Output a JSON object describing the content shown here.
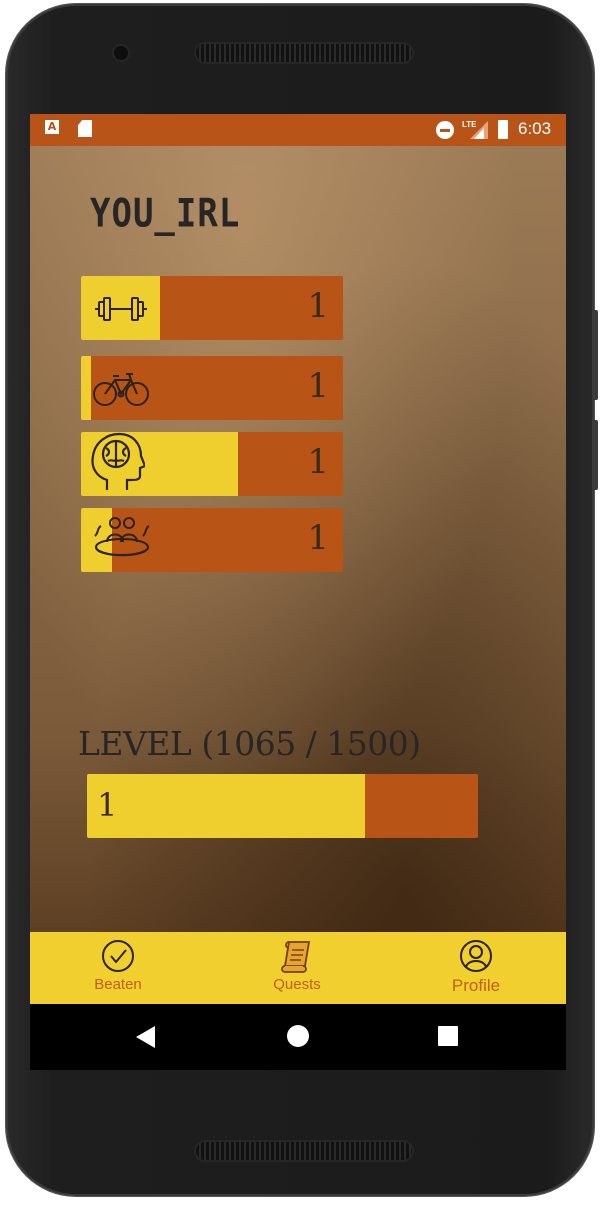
{
  "status_bar": {
    "time": "6:03",
    "icons": [
      "a-notification-icon",
      "sd-card-icon",
      "do-not-disturb-icon",
      "lte-signal-icon",
      "battery-charging-icon"
    ],
    "network_label": "LTE"
  },
  "app": {
    "title": "YOU_IRL"
  },
  "stats": [
    {
      "icon": "dumbbell-icon",
      "value": "1",
      "progress": 0.3
    },
    {
      "icon": "bicycle-icon",
      "value": "1",
      "progress": 0.04
    },
    {
      "icon": "brain-head-icon",
      "value": "1",
      "progress": 0.6
    },
    {
      "icon": "social-hot-tub-icon",
      "value": "1",
      "progress": 0.12
    }
  ],
  "level": {
    "label": "LEVEL (1065 / 1500)",
    "value": "1",
    "current": 1065,
    "max": 1500
  },
  "bottom_nav": {
    "items": [
      {
        "label": "Beaten",
        "icon": "check-circle-icon"
      },
      {
        "label": "Quests",
        "icon": "scroll-icon"
      },
      {
        "label": "Profile",
        "icon": "profile-icon"
      }
    ]
  },
  "colors": {
    "status_bar": "#b85418",
    "bar_bg": "#b95417",
    "bar_fill": "#efcf2d",
    "nav_bg": "#f0cf2e",
    "nav_text": "#c2601c"
  }
}
